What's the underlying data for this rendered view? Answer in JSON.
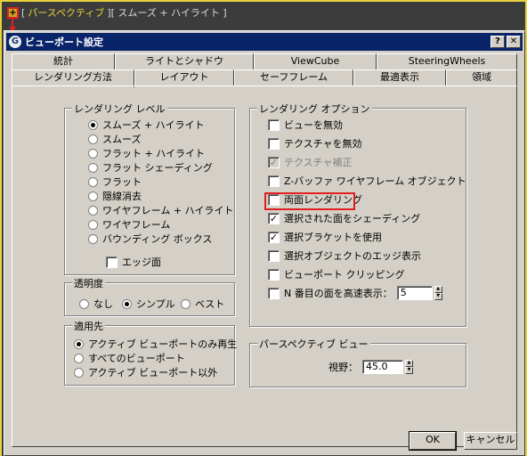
{
  "viewport": {
    "plus": "+",
    "label_prefix": "[",
    "view_name": "パースペクティブ",
    "shading": "][ スムーズ + ハイライト ]"
  },
  "dialog": {
    "title": "ビューポート設定",
    "app_icon": "G",
    "help_btn": "?",
    "close_btn": "✕"
  },
  "tabs": {
    "back": [
      "統計",
      "ライトとシャドウ",
      "ViewCube",
      "SteeringWheels"
    ],
    "front": [
      "レンダリング方法",
      "レイアウト",
      "セーフフレーム",
      "最適表示",
      "領域"
    ]
  },
  "rendering_level": {
    "title": "レンダリング レベル",
    "options": [
      "スムーズ + ハイライト",
      "スムーズ",
      "フラット + ハイライト",
      "フラット シェーディング",
      "フラット",
      "隠線消去",
      "ワイヤフレーム + ハイライト",
      "ワイヤフレーム",
      "バウンディング ボックス"
    ],
    "selected": 0,
    "edge_faces": "エッジ面"
  },
  "transparency": {
    "title": "透明度",
    "options": [
      "なし",
      "シンプル",
      "ベスト"
    ],
    "selected": 1
  },
  "apply_to": {
    "title": "適用先",
    "options": [
      "アクティブ ビューポートのみ再生",
      "すべてのビューポート",
      "アクティブ ビューポート以外"
    ],
    "selected": 0
  },
  "rendering_options": {
    "title": "レンダリング オプション",
    "items": [
      {
        "label": "ビューを無効",
        "checked": false,
        "disabled": false
      },
      {
        "label": "テクスチャを無効",
        "checked": false,
        "disabled": false
      },
      {
        "label": "テクスチャ補正",
        "checked": true,
        "disabled": true
      },
      {
        "label": "Z-バッファ ワイヤフレーム オブジェクト",
        "checked": false,
        "disabled": false
      },
      {
        "label": "両面レンダリング",
        "checked": false,
        "disabled": false
      },
      {
        "label": "選択された面をシェーディング",
        "checked": true,
        "disabled": false
      },
      {
        "label": "選択ブラケットを使用",
        "checked": true,
        "disabled": false
      },
      {
        "label": "選択オブジェクトのエッジ表示",
        "checked": false,
        "disabled": false
      },
      {
        "label": "ビューポート クリッピング",
        "checked": false,
        "disabled": false
      },
      {
        "label": "N 番目の面を高速表示：",
        "checked": false,
        "disabled": false
      }
    ],
    "nth_face_value": "5"
  },
  "perspective_view": {
    "title": "パースペクティブ ビュー",
    "fov_label": "視野：",
    "fov_value": "45.0"
  },
  "buttons": {
    "ok": "OK",
    "cancel": "キャンセル"
  },
  "colors": {
    "highlight": "#e02020",
    "viewport_border": "#e6d23a",
    "title_bar": "#0a246a"
  }
}
